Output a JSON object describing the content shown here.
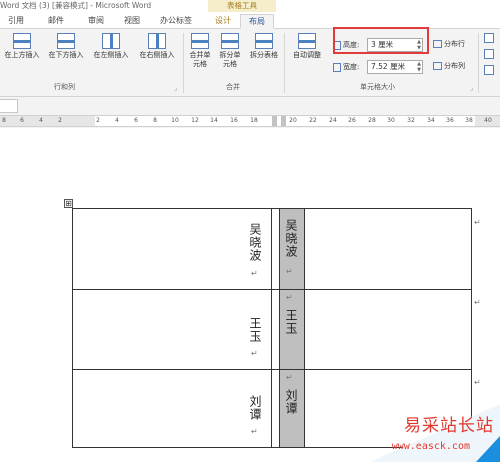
{
  "titlebar": {
    "title": "Word 文档 (3) [兼容模式] - Microsoft Word",
    "context_group": "表格工具"
  },
  "tabs": [
    {
      "label": "引用",
      "active": false
    },
    {
      "label": "邮件",
      "active": false
    },
    {
      "label": "审阅",
      "active": false
    },
    {
      "label": "视图",
      "active": false
    },
    {
      "label": "办公标签",
      "active": false
    },
    {
      "label": "设计",
      "active": false,
      "contextual": true
    },
    {
      "label": "布局",
      "active": true,
      "contextual": true
    }
  ],
  "ribbon": {
    "rows_cols": {
      "insert_above": "在上方插入",
      "insert_below": "在下方插入",
      "insert_left": "在左侧插入",
      "insert_right": "在右侧插入",
      "group_label": "行和列"
    },
    "merge": {
      "merge_cells": "合并单元格",
      "split_cells": "拆分单元格",
      "split_table": "拆分表格",
      "group_label": "合并"
    },
    "cell_size": {
      "autofit": "自动调整",
      "height_label": "高度:",
      "height_value": "3 厘米",
      "width_label": "宽度:",
      "width_value": "7.52 厘米",
      "distribute_rows": "分布行",
      "distribute_cols": "分布列",
      "group_label": "单元格大小"
    }
  },
  "ruler": {
    "ticks": [
      "8",
      "6",
      "4",
      "2",
      "",
      "2",
      "4",
      "6",
      "8",
      "10",
      "12",
      "14",
      "16",
      "18",
      "20",
      "22",
      "24",
      "26",
      "28",
      "30",
      "32",
      "34",
      "36",
      "38",
      "40",
      "42",
      "44"
    ]
  },
  "table": {
    "handle_glyph": "⊞",
    "rows": [
      {
        "name": "吴晓波",
        "name_shaded": "吴晓波"
      },
      {
        "name": "王玉",
        "name_shaded": "王玉"
      },
      {
        "name": "刘谭",
        "name_shaded": "刘谭"
      }
    ],
    "para_mark": "↵"
  },
  "watermark": {
    "title": "易采站长站",
    "url": "www.easck.com"
  }
}
